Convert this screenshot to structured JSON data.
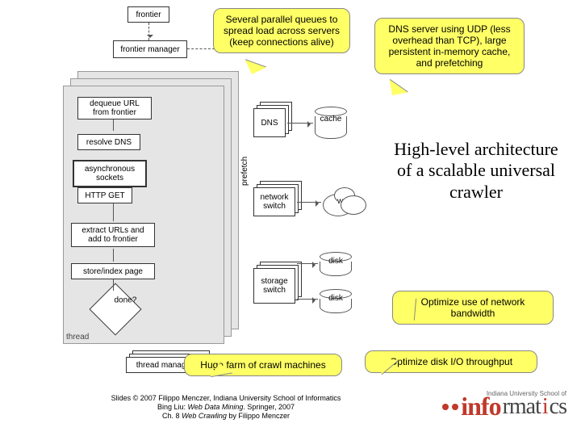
{
  "callouts": {
    "queues": "Several parallel queues to spread load across servers (keep connections alive)",
    "dns": "DNS server using UDP (less overhead than TCP), large persistent in-memory cache, and prefetching",
    "farm": "Huge farm of crawl machines",
    "bandwidth": "Optimize use of network bandwidth",
    "disk": "Optimize disk I/O throughput"
  },
  "title": "High-level architecture of a scalable universal crawler",
  "diagram": {
    "frontier": "frontier",
    "frontier_manager": "frontier manager",
    "dequeue": "dequeue URL from frontier",
    "resolve_dns": "resolve DNS",
    "async_sockets": "asynchronous sockets",
    "http_get": "HTTP GET",
    "extract": "extract URLs and add to frontier",
    "store": "store/index page",
    "done": "done?",
    "thread": "thread",
    "thread_manager": "thread manager",
    "dns": "DNS",
    "cache": "cache",
    "prefetch": "prefetch",
    "network_switch": "network switch",
    "web": "web",
    "storage_switch": "storage switch",
    "disk1": "disk",
    "disk2": "disk"
  },
  "credit": {
    "l1_a": "Slides © 2007 Filippo Menczer, Indiana University School of Informatics",
    "l2_a": "Bing Liu: ",
    "l2_b": "Web Data Mining",
    "l2_c": ". Springer, 2007",
    "l3_a": "Ch. 8 ",
    "l3_b": "Web Crawling",
    "l3_c": " by Filippo Menczer"
  },
  "logo": {
    "tag": "Indiana University School of",
    "part1": "info",
    "part2": "rmat",
    "part3": "cs"
  }
}
